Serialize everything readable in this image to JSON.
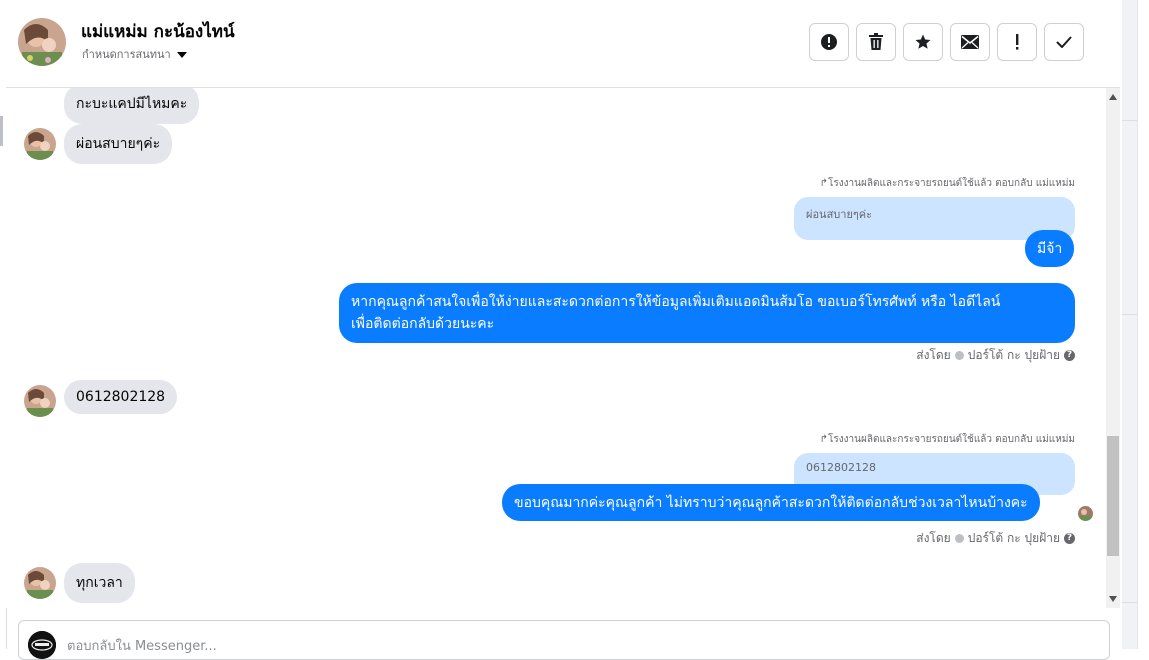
{
  "header": {
    "contact_name": "แม่แหม่ม กะน้องไทน์",
    "conversation_menu": "กำหนดการสนทนา",
    "actions": [
      {
        "name": "report-button",
        "icon": "alert-circle-icon",
        "glyph": "!"
      },
      {
        "name": "delete-button",
        "icon": "trash-icon",
        "glyph": ""
      },
      {
        "name": "star-button",
        "icon": "star-icon",
        "glyph": "★"
      },
      {
        "name": "mark-unread-button",
        "icon": "envelope-icon",
        "glyph": ""
      },
      {
        "name": "important-button",
        "icon": "exclamation-icon",
        "glyph": "!"
      },
      {
        "name": "done-button",
        "icon": "checkmark-icon",
        "glyph": "✓"
      }
    ]
  },
  "messages": {
    "m1": "กะบะแคปมีไหมคะ",
    "m2": "ผ่อนสบายๆค่ะ",
    "reply1_meta": "โรงงานผลิตและกระจายรถยนต์ใช้แล้ว ตอบกลับ แม่แหม่ม",
    "reply1_quote": "ผ่อนสบายๆค่ะ",
    "m3": "มีจ้า",
    "m4_line1": "หากคุณลูกค้าสนใจเพื่อให้ง่ายและสะดวกต่อการให้ข้อมูลเพิ่มเติมแอดมินส้มโอ ขอเบอร์โทรศัพท์ หรือ ไอดีไลน์",
    "m4_line2": "เพื่อติดต่อกลับด้วยนะคะ",
    "sent_by_1": "ส่งโดย",
    "sender_name_1": "ปอร์โต้ กะ ปุยฝ้าย",
    "m5": "0612802128",
    "reply2_meta": "โรงงานผลิตและกระจายรถยนต์ใช้แล้ว ตอบกลับ แม่แหม่ม",
    "reply2_quote": "0612802128",
    "m6": "ขอบคุณมากค่ะคุณลูกค้า ไม่ทราบว่าคุณลูกค้าสะดวกให้ติดต่อกลับช่วงเวลาไหนบ้างคะ",
    "sent_by_2": "ส่งโดย",
    "sender_name_2": "ปอร์โต้ กะ ปุยฝ้าย",
    "m7": "ทุกเวลา"
  },
  "composer": {
    "placeholder": "ตอบกลับใน Messenger..."
  },
  "colors": {
    "outgoing_bubble": "#0a7cff",
    "incoming_bubble": "#e4e6eb",
    "quoted_bubble": "#cce4ff",
    "meta_text": "#65676b"
  }
}
